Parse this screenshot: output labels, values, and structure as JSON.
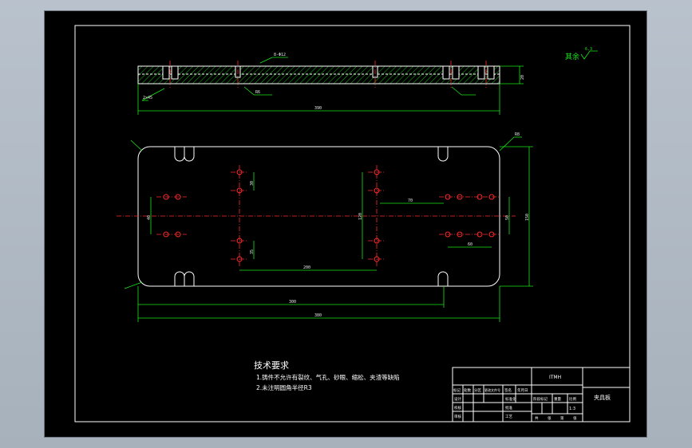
{
  "title_block": {
    "part_code": "ITMH",
    "part_name": "夹具板",
    "scale": "1:3",
    "headers": [
      "标记",
      "处数",
      "分区",
      "更改文件号",
      "签名",
      "年月日"
    ],
    "right_headers": [
      "阶段标记",
      "重量",
      "比例"
    ],
    "roles": [
      "设计",
      "校核",
      "审核",
      "工艺"
    ],
    "mid_labels": [
      "标准化",
      "批准"
    ],
    "sheet_labels": [
      "共",
      "张",
      "第",
      "张"
    ]
  },
  "tech_requirements": {
    "heading": "技术要求",
    "items": [
      "1.铸件不允许有裂纹、气孔、砂眼、缩松、夹渣等缺陷",
      "2.未注明圆角半径R3"
    ]
  },
  "surface_note": {
    "label": "其余",
    "value": "6.3"
  },
  "dims": {
    "plate_thickness": "20",
    "top_left_note": "8-Φ12",
    "front_total": "390",
    "chamfer_left": "2x45",
    "slot_label": "R6",
    "span_70": "70",
    "span_120": "120",
    "span_200": "200",
    "span_150": "150",
    "span_60": "60",
    "span_40": "40",
    "span_30": "30",
    "span_35": "35",
    "span_50": "50",
    "span_300": "300",
    "span_380": "380",
    "radius_right": "R8"
  },
  "colors": {
    "outline": "#ffffff",
    "dimension": "#19e619",
    "centerline": "#ff2a2a",
    "background": "#000000"
  }
}
